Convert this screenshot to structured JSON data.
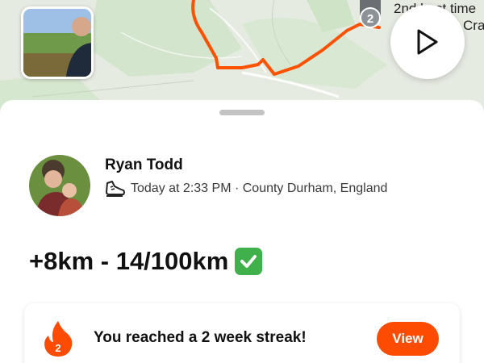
{
  "map": {
    "segment_label_line1": "2nd best time",
    "segment_label_line2": "Crai",
    "medal_rank": "2"
  },
  "activity": {
    "athlete_name": "Ryan Todd",
    "meta": "Today at 2:33 PM · County Durham, England",
    "title": "+8km - 14/100km"
  },
  "streak": {
    "count": "2",
    "text": "You reached a 2 week streak!",
    "view_label": "View"
  },
  "colors": {
    "accent": "#fc4c02",
    "route": "#fc5200",
    "map_green": "#cfe3c6",
    "map_bg": "#e4eadf",
    "check_green": "#3fb04a"
  }
}
